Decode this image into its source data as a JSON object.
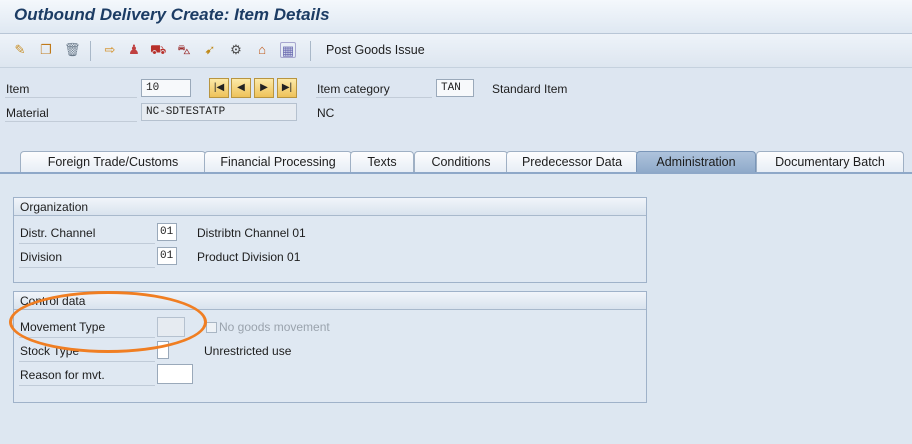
{
  "window": {
    "title": "Outbound Delivery  Create: Item Details"
  },
  "toolbar": {
    "icons": [
      "edit-icon",
      "copy-icon",
      "trash-icon",
      "picking-icon",
      "partner-icon",
      "shipment-icon",
      "vehicle-icon",
      "export-icon",
      "material-icon",
      "home-icon",
      "grid-icon"
    ],
    "post_goods_issue": "Post Goods Issue"
  },
  "header": {
    "item_label": "Item",
    "item_value": "10",
    "item_category_label": "Item category",
    "item_category_value": "TAN",
    "item_category_text": "Standard Item",
    "material_label": "Material",
    "material_value": "NC-SDTESTATP",
    "material_text": "NC",
    "nav": [
      "|◀",
      "◀",
      "▶",
      "▶|"
    ]
  },
  "tabs": [
    {
      "label": "Foreign Trade/Customs"
    },
    {
      "label": "Financial Processing"
    },
    {
      "label": "Texts"
    },
    {
      "label": "Conditions"
    },
    {
      "label": "Predecessor Data"
    },
    {
      "label": "Administration",
      "active": true
    },
    {
      "label": "Documentary Batch"
    }
  ],
  "organization": {
    "title": "Organization",
    "distr_channel_label": "Distr. Channel",
    "distr_channel_value": "01",
    "distr_channel_text": "Distribtn Channel 01",
    "division_label": "Division",
    "division_value": "01",
    "division_text": "Product Division 01"
  },
  "control": {
    "title": "Control data",
    "movement_type_label": "Movement Type",
    "movement_type_value": "",
    "no_goods_movement_label": "No goods movement",
    "stock_type_label": "Stock Type",
    "stock_type_value": "",
    "stock_type_text": "Unrestricted use",
    "reason_label": "Reason for mvt.",
    "reason_value": ""
  },
  "colors": {
    "highlight": "#f07e22",
    "active_tab": "#8ea9c9",
    "panel": "#dde7f1"
  }
}
